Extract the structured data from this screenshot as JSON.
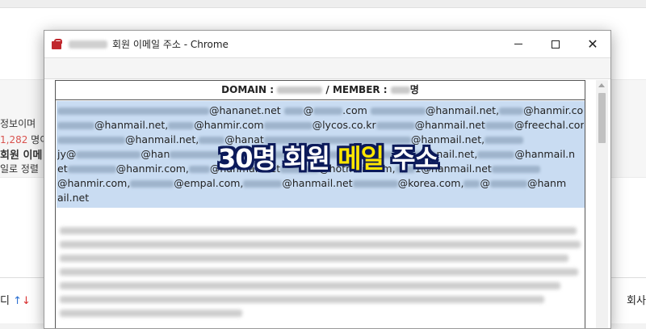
{
  "background": {
    "line1": "정보이며",
    "line2_num": "1,282",
    "line2_suffix": " 명이",
    "line3": "회원 이메",
    "line4": "일로 정렬",
    "sort_label": "디",
    "sort_up": "↑",
    "sort_down": "↓",
    "right_col": "회사"
  },
  "window": {
    "title": "회원 이메일 주소 - Chrome"
  },
  "panel": {
    "domain_label": "DOMAIN :",
    "member_label": "/ MEMBER :",
    "member_suffix": "명"
  },
  "emails": {
    "l1_a": "@hananet.net",
    "l1_b": "@",
    "l1_c": ".com",
    "l1_d": "@hanmail.net,",
    "l1_e": "@hanmir.co",
    "l2_a": "@hanmail.net,",
    "l2_b": "@hanmir.com",
    "l2_c": "@lycos.co.kr",
    "l2_d": "@hanmail.net",
    "l2_e": "@freechal.com",
    "l3_a": "@hanmail.net,",
    "l3_b": "@hanat",
    "l3_c": "@hanmail.net,",
    "l4_a": "jy@",
    "l4_b": "@han",
    "l4_c": "nail.net,",
    "l4_d": "@hanmail.n",
    "l5_a": "et",
    "l5_b": "@hanmir.com,",
    "l5_c": "@hanmail.net",
    "l5_d": "@hotmail.com,",
    "l5_e": "1@hanmail.net",
    "l6_a": "@hanmir.com,",
    "l6_b": "@empal.com,",
    "l6_c": "@hanmail.net",
    "l6_d": "@korea.com,",
    "l6_e": "@",
    "l6_f": "@hanm",
    "l7_a": "ail.net"
  },
  "overlay": {
    "text_a": "30명 회원",
    "text_b": "메일",
    "text_c": "주소"
  },
  "colors": {
    "selection": "#c9dcf2",
    "overlay_fill": "#ffffff",
    "overlay_highlight": "#ffe600",
    "overlay_outline": "#0c1a5a",
    "icon_red": "#c0272d"
  }
}
